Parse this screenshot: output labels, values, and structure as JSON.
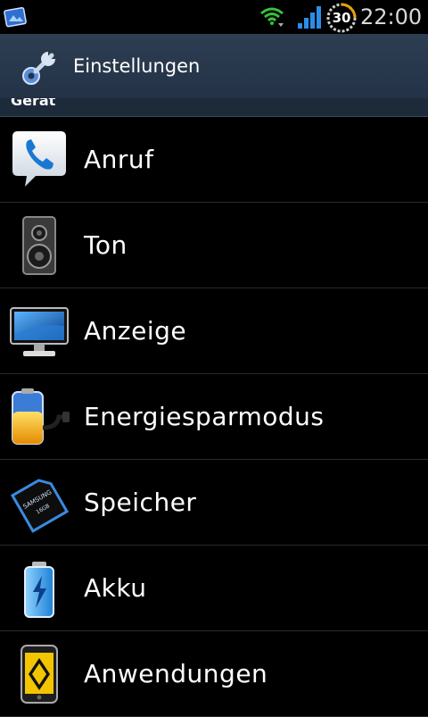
{
  "status_bar": {
    "battery_level": "30",
    "time": "22:00",
    "icons": [
      "gallery-icon",
      "wifi-icon",
      "signal-icon",
      "battery-icon"
    ]
  },
  "title_bar": {
    "title": "Einstellungen",
    "icon": "settings-wrench-icon"
  },
  "section": {
    "header": "Gerät"
  },
  "items": [
    {
      "label": "Anruf",
      "icon": "phone-icon"
    },
    {
      "label": "Ton",
      "icon": "speaker-icon"
    },
    {
      "label": "Anzeige",
      "icon": "monitor-icon"
    },
    {
      "label": "Energiesparmodus",
      "icon": "energy-battery-icon"
    },
    {
      "label": "Speicher",
      "icon": "sd-card-icon"
    },
    {
      "label": "Akku",
      "icon": "battery-icon"
    },
    {
      "label": "Anwendungen",
      "icon": "applications-icon"
    }
  ],
  "colors": {
    "title_bar": "#263649",
    "section_header": "#1c2a3a",
    "background": "#000000",
    "text": "#ffffff"
  }
}
